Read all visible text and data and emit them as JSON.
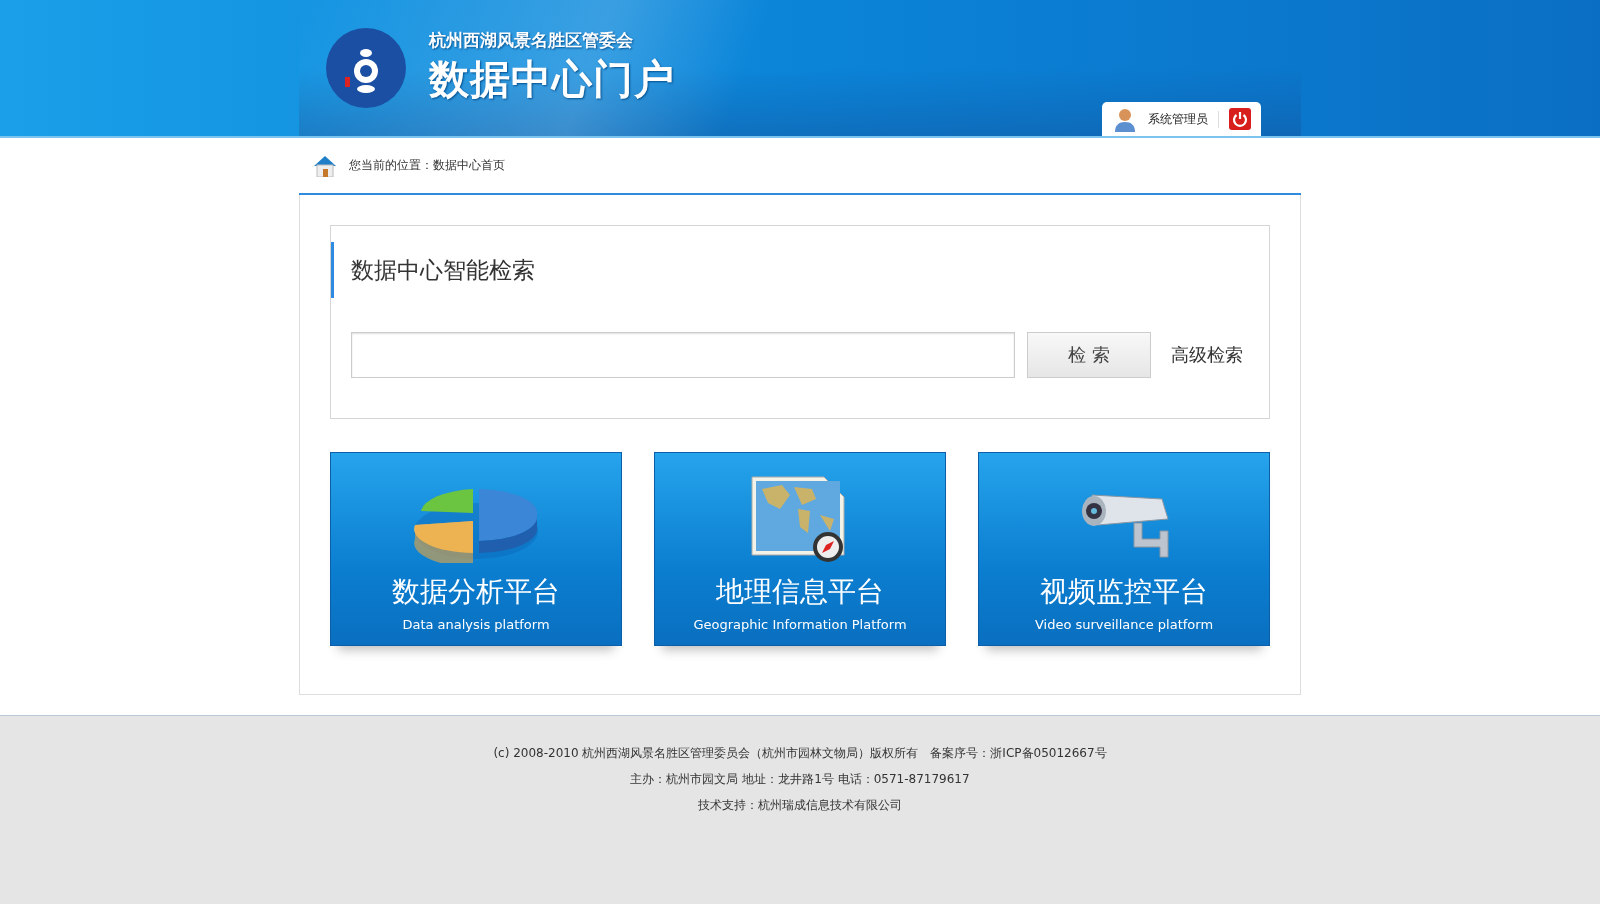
{
  "header": {
    "org": "杭州西湖风景名胜区管委会",
    "title": "数据中心门户",
    "user": "系统管理员"
  },
  "breadcrumb": {
    "label": "您当前的位置：",
    "current": "数据中心首页"
  },
  "search": {
    "title": "数据中心智能检索",
    "button": "检 索",
    "advanced": "高级检索"
  },
  "platforms": [
    {
      "kind": "chart",
      "title": "数据分析平台",
      "subtitle": "Data analysis platform"
    },
    {
      "kind": "map",
      "title": "地理信息平台",
      "subtitle": "Geographic Information Platform"
    },
    {
      "kind": "camera",
      "title": "视频监控平台",
      "subtitle": "Video surveillance platform"
    }
  ],
  "footer": [
    "(c) 2008-2010 杭州西湖风景名胜区管理委员会（杭州市园林文物局）版权所有　备案序号：浙ICP备05012667号",
    "主办：杭州市园文局 地址：龙井路1号 电话：0571-87179617",
    "技术支持：杭州瑞成信息技术有限公司"
  ]
}
